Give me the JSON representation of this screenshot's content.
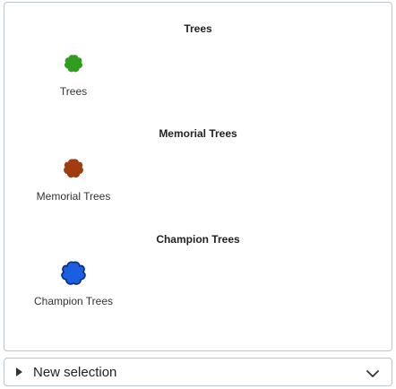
{
  "legend": {
    "sections": [
      {
        "title": "Trees",
        "symbol_icon": "tree-canopy-icon",
        "symbol_color": "#2f9e1e",
        "symbol_label": "Trees"
      },
      {
        "title": "Memorial Trees",
        "symbol_icon": "tree-canopy-icon",
        "symbol_color": "#a03c10",
        "symbol_label": "Memorial Trees"
      },
      {
        "title": "Champion Trees",
        "symbol_icon": "tree-canopy-icon",
        "symbol_color": "#1a5fe0",
        "symbol_label": "Champion Trees"
      }
    ]
  },
  "selection": {
    "label": "New selection",
    "expand_icon": "triangle-right-icon",
    "dropdown_icon": "chevron-down-icon"
  }
}
